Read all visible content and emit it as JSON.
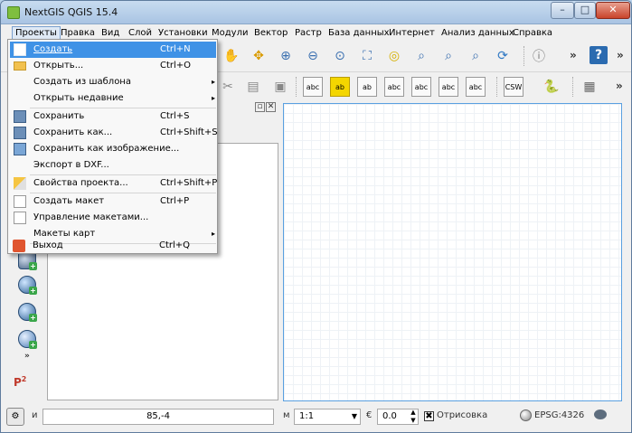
{
  "window": {
    "title": "NextGIS QGIS 15.4"
  },
  "menubar": {
    "items": [
      "Проекты",
      "Правка",
      "Вид",
      "Слой",
      "Установки",
      "Модули",
      "Вектор",
      "Растр",
      "База данных",
      "Интернет",
      "Анализ данных",
      "Справка"
    ]
  },
  "project_menu": {
    "items": [
      {
        "label": "Создать",
        "shortcut": "Ctrl+N",
        "icon": "new-document-icon",
        "highlighted": true
      },
      {
        "label": "Открыть...",
        "shortcut": "Ctrl+O",
        "icon": "folder-icon"
      },
      {
        "label": "Создать из шаблона",
        "submenu": true
      },
      {
        "label": "Открыть недавние",
        "submenu": true
      },
      {
        "label": "Сохранить",
        "shortcut": "Ctrl+S",
        "icon": "save-icon"
      },
      {
        "label": "Сохранить как...",
        "shortcut": "Ctrl+Shift+S",
        "icon": "save-as-icon"
      },
      {
        "label": "Сохранить как изображение...",
        "icon": "save-image-icon"
      },
      {
        "label": "Экспорт в DXF..."
      },
      {
        "label": "Свойства проекта...",
        "shortcut": "Ctrl+Shift+P",
        "icon": "properties-icon"
      },
      {
        "label": "Создать макет",
        "shortcut": "Ctrl+P",
        "icon": "new-layout-icon"
      },
      {
        "label": "Управление макетами...",
        "icon": "layout-manager-icon"
      },
      {
        "label": "Макеты карт",
        "submenu": true
      },
      {
        "label": "Выход",
        "shortcut": "Ctrl+Q",
        "icon": "exit-icon"
      }
    ]
  },
  "toolbar2": {
    "csw_label": "CSW"
  },
  "statusbar": {
    "coord_label": "и",
    "coordinates": "85,-4",
    "scale_label": "м",
    "scale": "1:1",
    "rotation_label": "€",
    "rotation": "0.0",
    "render_label": "Отрисовка",
    "crs": "EPSG:4326"
  },
  "sidebar": {
    "label_p": "P"
  },
  "colors": {
    "highlight": "#3f92e6",
    "canvas_border": "#5aa0e0"
  }
}
